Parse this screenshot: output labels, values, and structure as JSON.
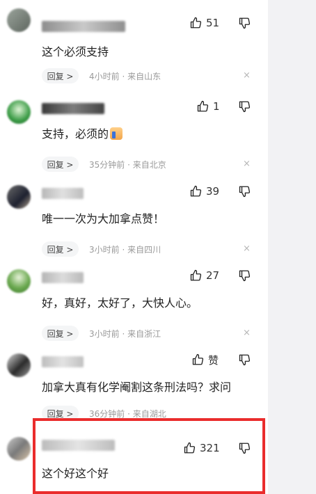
{
  "colors": {
    "highlight": "#ea2c2c",
    "meta_text": "#9a9a9a",
    "reply_bg": "#f4f5f6",
    "sidebar_bg": "#f2f2f4"
  },
  "comments": [
    {
      "like_count": "51",
      "text": "这个必须支持",
      "emoji": "",
      "reply_label": "回复 >",
      "meta": "4小时前 · 来自山东",
      "close": "×"
    },
    {
      "like_count": "1",
      "text": "支持，必须的",
      "emoji": "thumbs-up-emoji",
      "reply_label": "回复 >",
      "meta": "35分钟前 · 来自北京",
      "close": "×"
    },
    {
      "like_count": "39",
      "text": "唯一一次为大加拿点赞！",
      "emoji": "",
      "reply_label": "回复 >",
      "meta": "3小时前 · 来自四川",
      "close": "×"
    },
    {
      "like_count": "27",
      "text": "好，真好，太好了，大快人心。",
      "emoji": "",
      "reply_label": "回复 >",
      "meta": "3小时前 · 来自浙江",
      "close": "×"
    },
    {
      "like_count": "赞",
      "text": "加拿大真有化学阉割这条刑法吗？求问",
      "emoji": "",
      "reply_label": "回复 >",
      "meta": "36分钟前 · 来自湖北",
      "close": "×"
    },
    {
      "like_count": "321",
      "text": "这个好这个好",
      "emoji": "",
      "reply_label": "",
      "meta": "",
      "close": ""
    }
  ]
}
